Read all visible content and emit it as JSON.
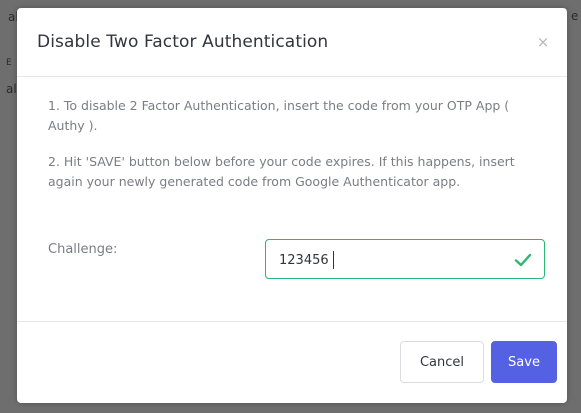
{
  "backdrop": {
    "fragments": [
      "al",
      "e",
      "E",
      "al"
    ]
  },
  "dialog": {
    "title": "Disable Two Factor Authentication",
    "close_icon": "close-icon",
    "close_glyph": "×",
    "instruction_1": "1. To disable 2 Factor Authentication, insert the code from your OTP App ( Authy ).",
    "instruction_2": "2. Hit 'SAVE' button below before your code expires. If this happens, insert again your newly generated code from Google Authenticator app.",
    "challenge": {
      "label": "Challenge:",
      "value": "123456",
      "status_icon": "checkmark-icon",
      "valid_color": "#2bb673"
    },
    "buttons": {
      "cancel_label": "Cancel",
      "save_label": "Save",
      "save_color": "#5561e3"
    }
  }
}
